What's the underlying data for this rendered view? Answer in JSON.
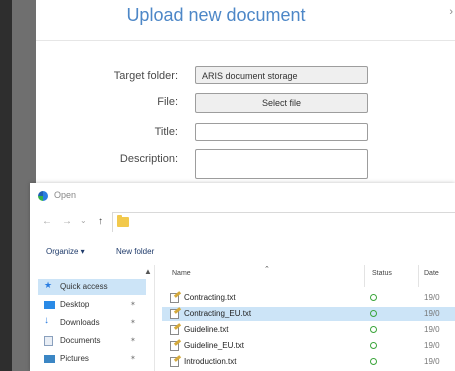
{
  "upload": {
    "title": "Upload new document",
    "labels": {
      "target_folder": "Target folder:",
      "file": "File:",
      "title": "Title:",
      "description": "Description:"
    },
    "target_folder_value": "ARIS document storage",
    "select_file_label": "Select file"
  },
  "open_dialog": {
    "title": "Open",
    "toolbar": {
      "organize": "Organize ▾",
      "new_folder": "New folder"
    },
    "nav": [
      {
        "label": "Quick access",
        "icon": "star-icon",
        "selected": true
      },
      {
        "label": "Desktop",
        "icon": "desktop-icon"
      },
      {
        "label": "Downloads",
        "icon": "download-icon"
      },
      {
        "label": "Documents",
        "icon": "documents-icon"
      },
      {
        "label": "Pictures",
        "icon": "pictures-icon"
      }
    ],
    "columns": {
      "name": "Name",
      "status": "Status",
      "date": "Date"
    },
    "files": [
      {
        "name": "Contracting.txt",
        "date": "19/0"
      },
      {
        "name": "Contracting_EU.txt",
        "date": "19/0",
        "selected": true
      },
      {
        "name": "Guideline.txt",
        "date": "19/0"
      },
      {
        "name": "Guideline_EU.txt",
        "date": "19/0"
      },
      {
        "name": "Introduction.txt",
        "date": "19/0"
      }
    ]
  }
}
